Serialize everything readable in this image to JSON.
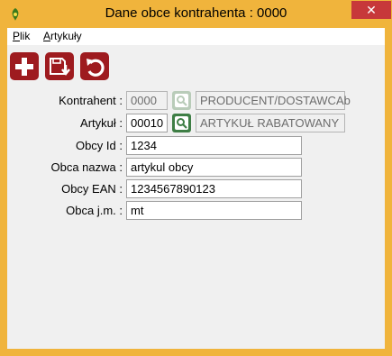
{
  "window": {
    "title": "Dane obce kontrahenta : 0000"
  },
  "menu": {
    "plik": "Plik",
    "plik_mnemonic": "P",
    "plik_rest": "lik",
    "artykuly": "Artykuły",
    "artykuly_mnemonic": "A",
    "artykuly_rest": "rtykuły"
  },
  "toolbar": {
    "add_icon": "plus-icon",
    "save_icon": "save-download-icon",
    "undo_icon": "undo-icon"
  },
  "form": {
    "kontrahent_label": "Kontrahent :",
    "kontrahent_code": "0000",
    "kontrahent_name": "PRODUCENT/DOSTAWCAb",
    "artykul_label": "Artykuł :",
    "artykul_code": "00010",
    "artykul_name": "ARTYKUŁ RABATOWANY",
    "obcy_id_label": "Obcy Id :",
    "obcy_id_value": "1234",
    "obca_nazwa_label": "Obca nazwa :",
    "obca_nazwa_value": "artykul obcy",
    "obcy_ean_label": "Obcy EAN :",
    "obcy_ean_value": "1234567890123",
    "obca_jm_label": "Obca j.m. :",
    "obca_jm_value": "mt"
  },
  "colors": {
    "frame": "#f0b43c",
    "toolbar_button": "#9e1b1f",
    "close_button": "#c7383a",
    "lookup_active": "#3e7e45",
    "lookup_disabled": "#b9ccb9"
  }
}
